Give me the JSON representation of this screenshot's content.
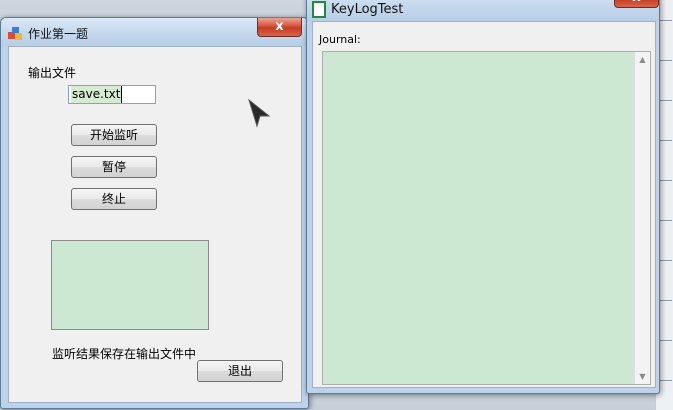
{
  "left_window": {
    "title": "作业第一题",
    "close_glyph": "x",
    "output_label": "输出文件",
    "filename_value": "save.txt",
    "buttons": {
      "start": "开始监听",
      "pause": "暂停",
      "stop": "终止",
      "exit": "退出"
    },
    "status_note": "监听结果保存在输出文件中"
  },
  "right_window": {
    "title": "KeyLogTest",
    "close_glyph": "x",
    "journal_label": "Journal:",
    "scroll_up_glyph": "▲",
    "scroll_down_glyph": "▼"
  },
  "colors": {
    "green_panel": "#cde8d2",
    "close_button": "#c53c22",
    "titlebar": "#c4d8ed"
  }
}
